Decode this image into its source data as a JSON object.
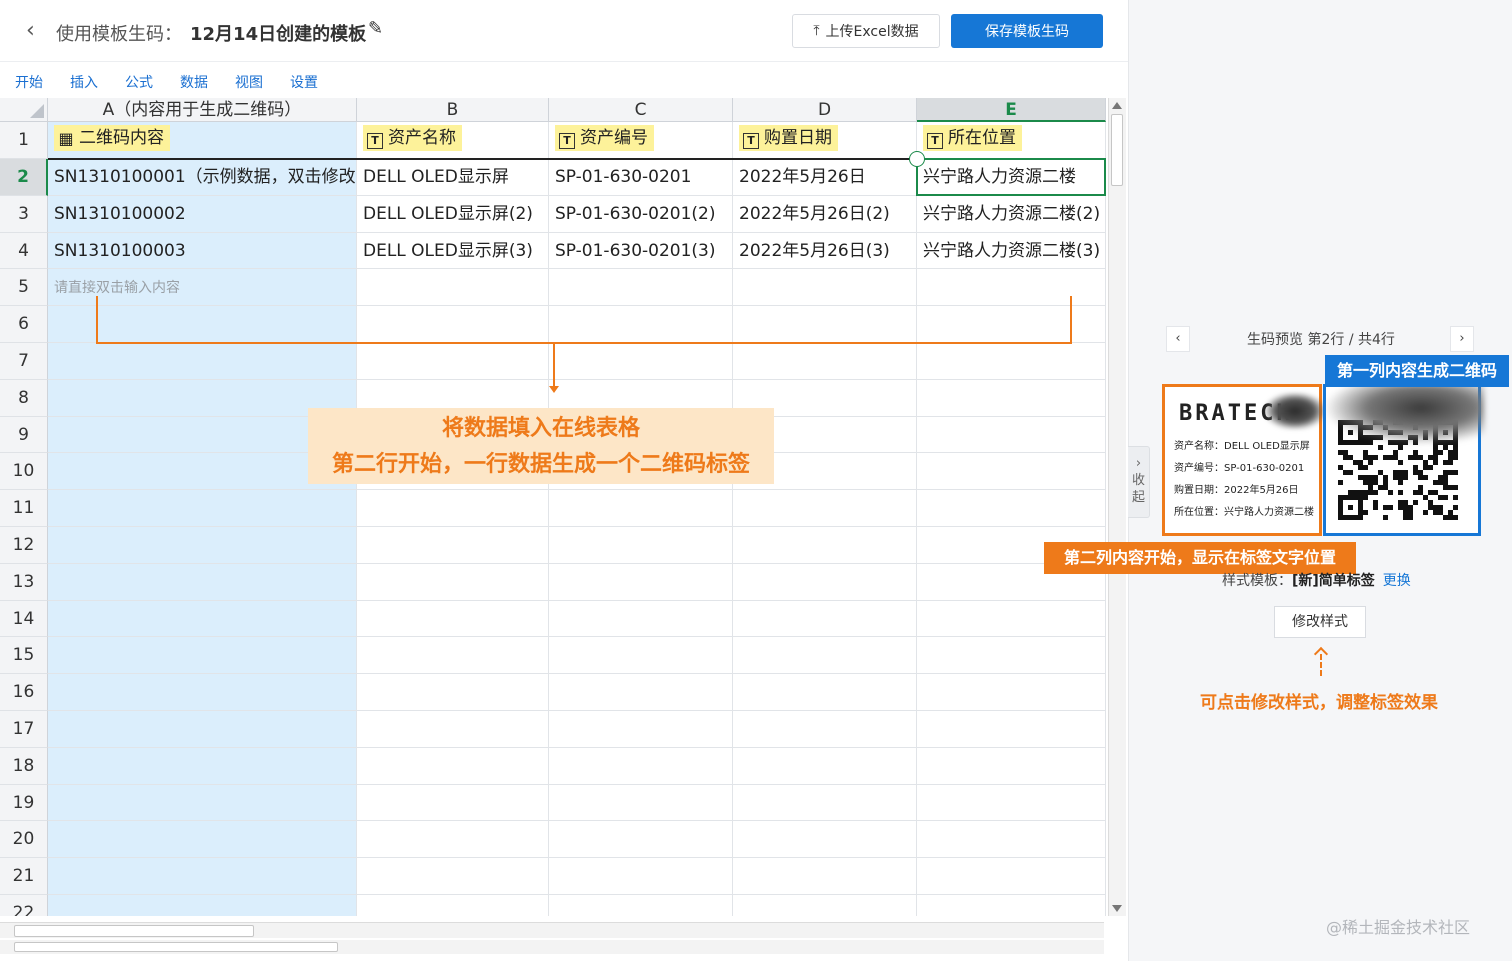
{
  "header": {
    "back_icon": "chevron-left-icon",
    "title_prefix": "使用模板生码：",
    "title_name": "12月14日创建的模板",
    "edit_icon": "pencil-icon",
    "upload_label": "上传Excel数据",
    "save_label": "保存模板生码"
  },
  "menu": [
    "开始",
    "插入",
    "公式",
    "数据",
    "视图",
    "设置"
  ],
  "grid": {
    "column_headers": [
      "A（内容用于生成二维码）",
      "B",
      "C",
      "D",
      "E"
    ],
    "selected_column": "E",
    "row_numbers": [
      "1",
      "2",
      "3",
      "4",
      "5",
      "6",
      "7",
      "8",
      "9",
      "10",
      "11",
      "12",
      "13",
      "14",
      "15",
      "16",
      "17",
      "18",
      "19",
      "20",
      "21",
      "22"
    ],
    "selected_row": "2",
    "header_row": [
      {
        "icon": "qr-icon",
        "label": "二维码内容"
      },
      {
        "icon": "text-field-icon",
        "label": "资产名称"
      },
      {
        "icon": "text-field-icon",
        "label": "资产编号"
      },
      {
        "icon": "text-field-icon",
        "label": "购置日期"
      },
      {
        "icon": "text-field-icon",
        "label": "所在位置"
      }
    ],
    "rows": [
      [
        "SN1310100001（示例数据，双击修改",
        "DELL OLED显示屏",
        "SP-01-630-0201",
        "2022年5月26日",
        "兴宁路人力资源二楼"
      ],
      [
        "SN1310100002",
        "DELL OLED显示屏(2)",
        "SP-01-630-0201(2)",
        "2022年5月26日(2)",
        "兴宁路人力资源二楼(2)"
      ],
      [
        "SN1310100003",
        "DELL OLED显示屏(3)",
        "SP-01-630-0201(3)",
        "2022年5月26日(3)",
        "兴宁路人力资源二楼(3)"
      ]
    ],
    "input_placeholder": "请直接双击输入内容"
  },
  "annotation": {
    "line1": "将数据填入在线表格",
    "line2": "第二行开始，一行数据生成一个二维码标签",
    "accent": "#ee7a1a"
  },
  "panel": {
    "collapse_label": [
      "收",
      "起"
    ],
    "preview_title": "生码预览 第2行 / 共4行",
    "qr_tag": "第一列内容生成二维码",
    "label_brand": "BRATECK",
    "label_lines": [
      "资产名称：DELL OLED显示屏",
      "资产编号：SP-01-630-0201",
      "购置日期：2022年5月26日",
      "所在位置：兴宁路人力资源二楼"
    ],
    "text_tag": "第二列内容开始，显示在标签文字位置",
    "style_label": "样式模板：",
    "style_name": "[新]简单标签",
    "style_change": "更换",
    "modify_button": "修改样式",
    "hint": "可点击修改样式，调整标签效果",
    "brand_color": "#1677d6"
  },
  "watermark": "@稀土掘金技术社区"
}
